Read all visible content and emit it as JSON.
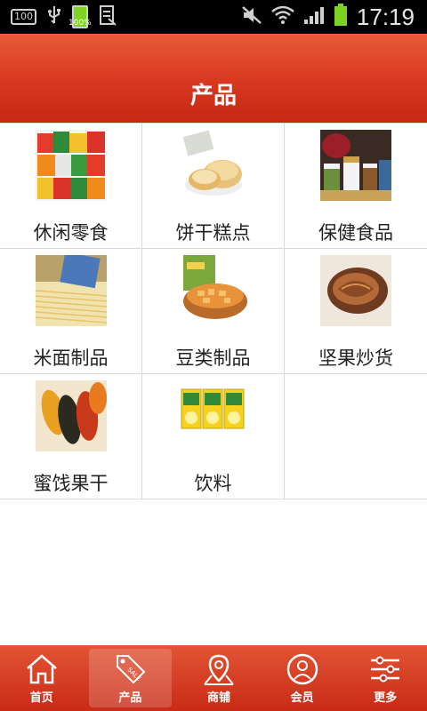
{
  "status_bar": {
    "indicator_box": "100",
    "battery_label": "100%",
    "time": "17:19"
  },
  "header": {
    "title": "产品"
  },
  "categories": [
    {
      "label": "休闲零食",
      "icon": "snacks-image"
    },
    {
      "label": "饼干糕点",
      "icon": "pastry-image"
    },
    {
      "label": "保健食品",
      "icon": "health-food-image"
    },
    {
      "label": "米面制品",
      "icon": "noodles-image"
    },
    {
      "label": "豆类制品",
      "icon": "beans-image"
    },
    {
      "label": "坚果炒货",
      "icon": "nuts-image"
    },
    {
      "label": "蜜饯果干",
      "icon": "dried-fruit-image"
    },
    {
      "label": "饮料",
      "icon": "drinks-image"
    }
  ],
  "tabbar": {
    "items": [
      {
        "label": "首页",
        "icon": "home-icon"
      },
      {
        "label": "产品",
        "icon": "sale-tag-icon",
        "active": true
      },
      {
        "label": "商铺",
        "icon": "map-pin-icon"
      },
      {
        "label": "会员",
        "icon": "user-icon"
      },
      {
        "label": "更多",
        "icon": "sliders-icon"
      }
    ]
  },
  "colors": {
    "brand": "#d8371f",
    "divider": "#d9d9d9"
  }
}
